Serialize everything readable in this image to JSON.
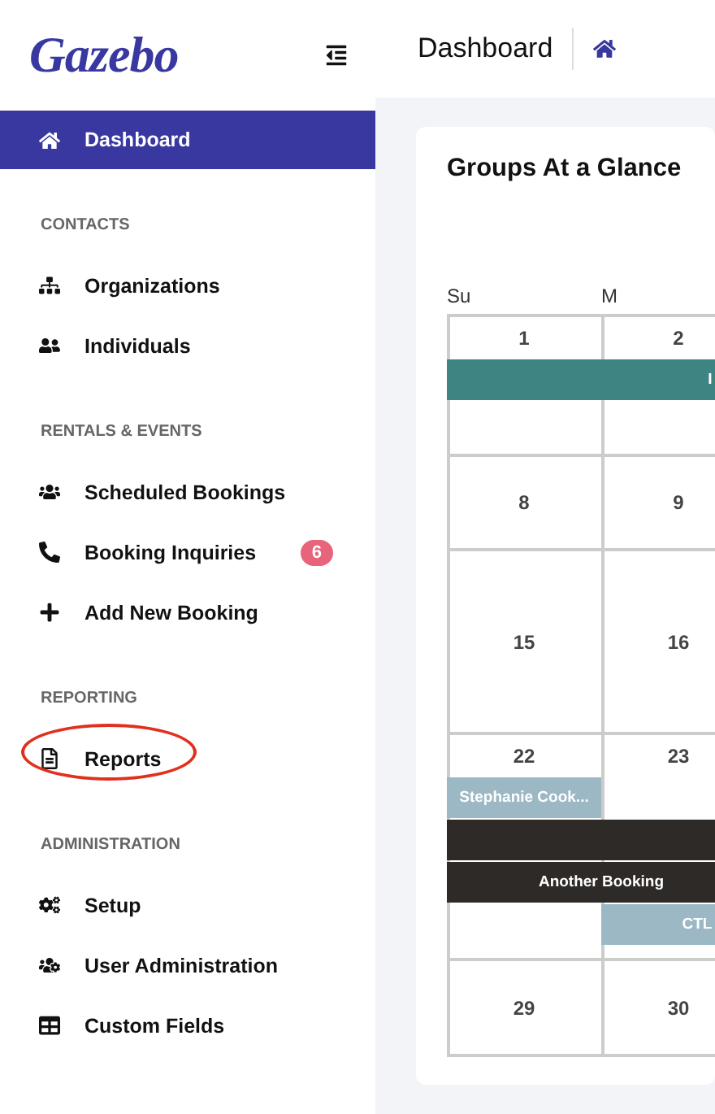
{
  "sidebar": {
    "logo": "Gazebo",
    "top_item": {
      "label": "Dashboard",
      "selected": true
    },
    "sections": [
      {
        "title": "CONTACTS",
        "items": [
          {
            "label": "Organizations",
            "selected": false
          },
          {
            "label": "Individuals",
            "selected": false
          }
        ]
      },
      {
        "title": "RENTALS & EVENTS",
        "items": [
          {
            "label": "Scheduled Bookings",
            "selected": false
          },
          {
            "label": "Booking Inquiries",
            "selected": false,
            "badge": "6"
          },
          {
            "label": "Add New Booking",
            "selected": false
          }
        ]
      },
      {
        "title": "REPORTING",
        "items": [
          {
            "label": "Reports",
            "selected": false,
            "circled": true
          }
        ]
      },
      {
        "title": "ADMINISTRATION",
        "items": [
          {
            "label": "Setup",
            "selected": false
          },
          {
            "label": "User Administration",
            "selected": false
          },
          {
            "label": "Custom Fields",
            "selected": false
          }
        ]
      }
    ]
  },
  "header": {
    "title": "Dashboard"
  },
  "card": {
    "title": "Groups At a Glance",
    "weekdays": [
      "Su",
      "M"
    ],
    "weeks": [
      {
        "days": [
          "1",
          "2"
        ],
        "events": [
          {
            "label": "I",
            "color": "#3e8482"
          }
        ]
      },
      {
        "days": [
          "8",
          "9"
        ]
      },
      {
        "days": [
          "15",
          "16"
        ]
      },
      {
        "days": [
          "22",
          "23"
        ],
        "events": [
          {
            "label": "Stephanie Cook...",
            "color": "#9bb8c4"
          },
          {
            "color": "#2e2a27"
          },
          {
            "label": "Another Booking",
            "color": "#2e2a27"
          },
          {
            "label": "CTL",
            "color": "#9bb8c4"
          }
        ]
      },
      {
        "days": [
          "29",
          "30"
        ]
      }
    ]
  }
}
